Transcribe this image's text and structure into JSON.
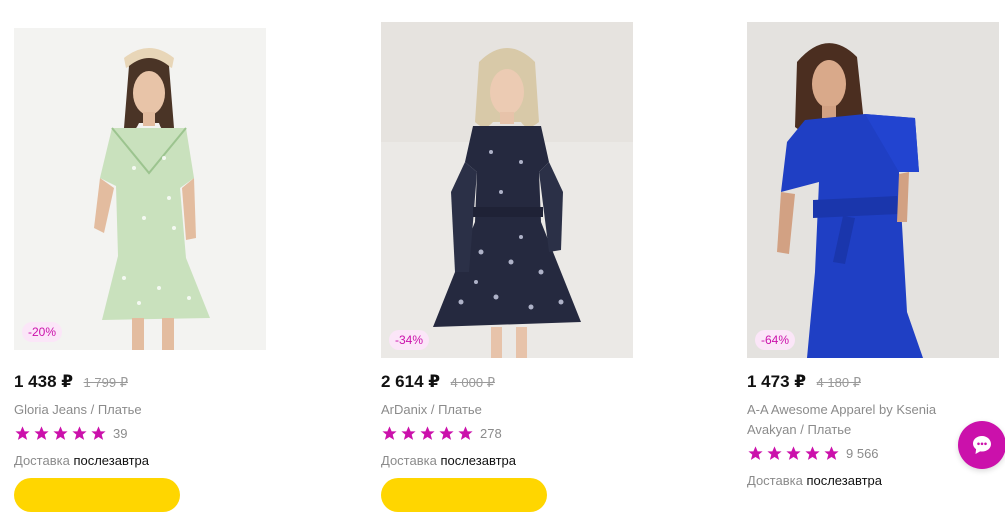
{
  "products": [
    {
      "discount": "-20%",
      "price": "1 438 ₽",
      "old_price": "1 799 ₽",
      "brand_line": "Gloria Jeans / Платье",
      "rating_count": "39",
      "rating_stars": 5,
      "image_desc": "dress-photo",
      "delivery_label": "Доставка",
      "delivery_value": "послезавтра"
    },
    {
      "discount": "-34%",
      "price": "2 614 ₽",
      "old_price": "4 000 ₽",
      "brand_line": "ArDanix / Платье",
      "rating_count": "278",
      "rating_stars": 5,
      "image_desc": "dress-photo",
      "delivery_label": "Доставка",
      "delivery_value": "послезавтра"
    },
    {
      "discount": "-64%",
      "price": "1 473 ₽",
      "old_price": "4 180 ₽",
      "brand_line": "A-A Awesome Apparel by Ksenia Avakyan / Платье",
      "rating_count": "9 566",
      "rating_stars": 5,
      "image_desc": "dress-photo",
      "delivery_label": "Доставка",
      "delivery_value": "послезавтра"
    }
  ],
  "colors": {
    "accent": "#cb11ab",
    "discount_bg": "#fbe6f8",
    "cart_button": "#ffd600",
    "muted_text": "#8b8b8b"
  },
  "icons": {
    "star": "star-icon",
    "chat": "chat-icon"
  }
}
